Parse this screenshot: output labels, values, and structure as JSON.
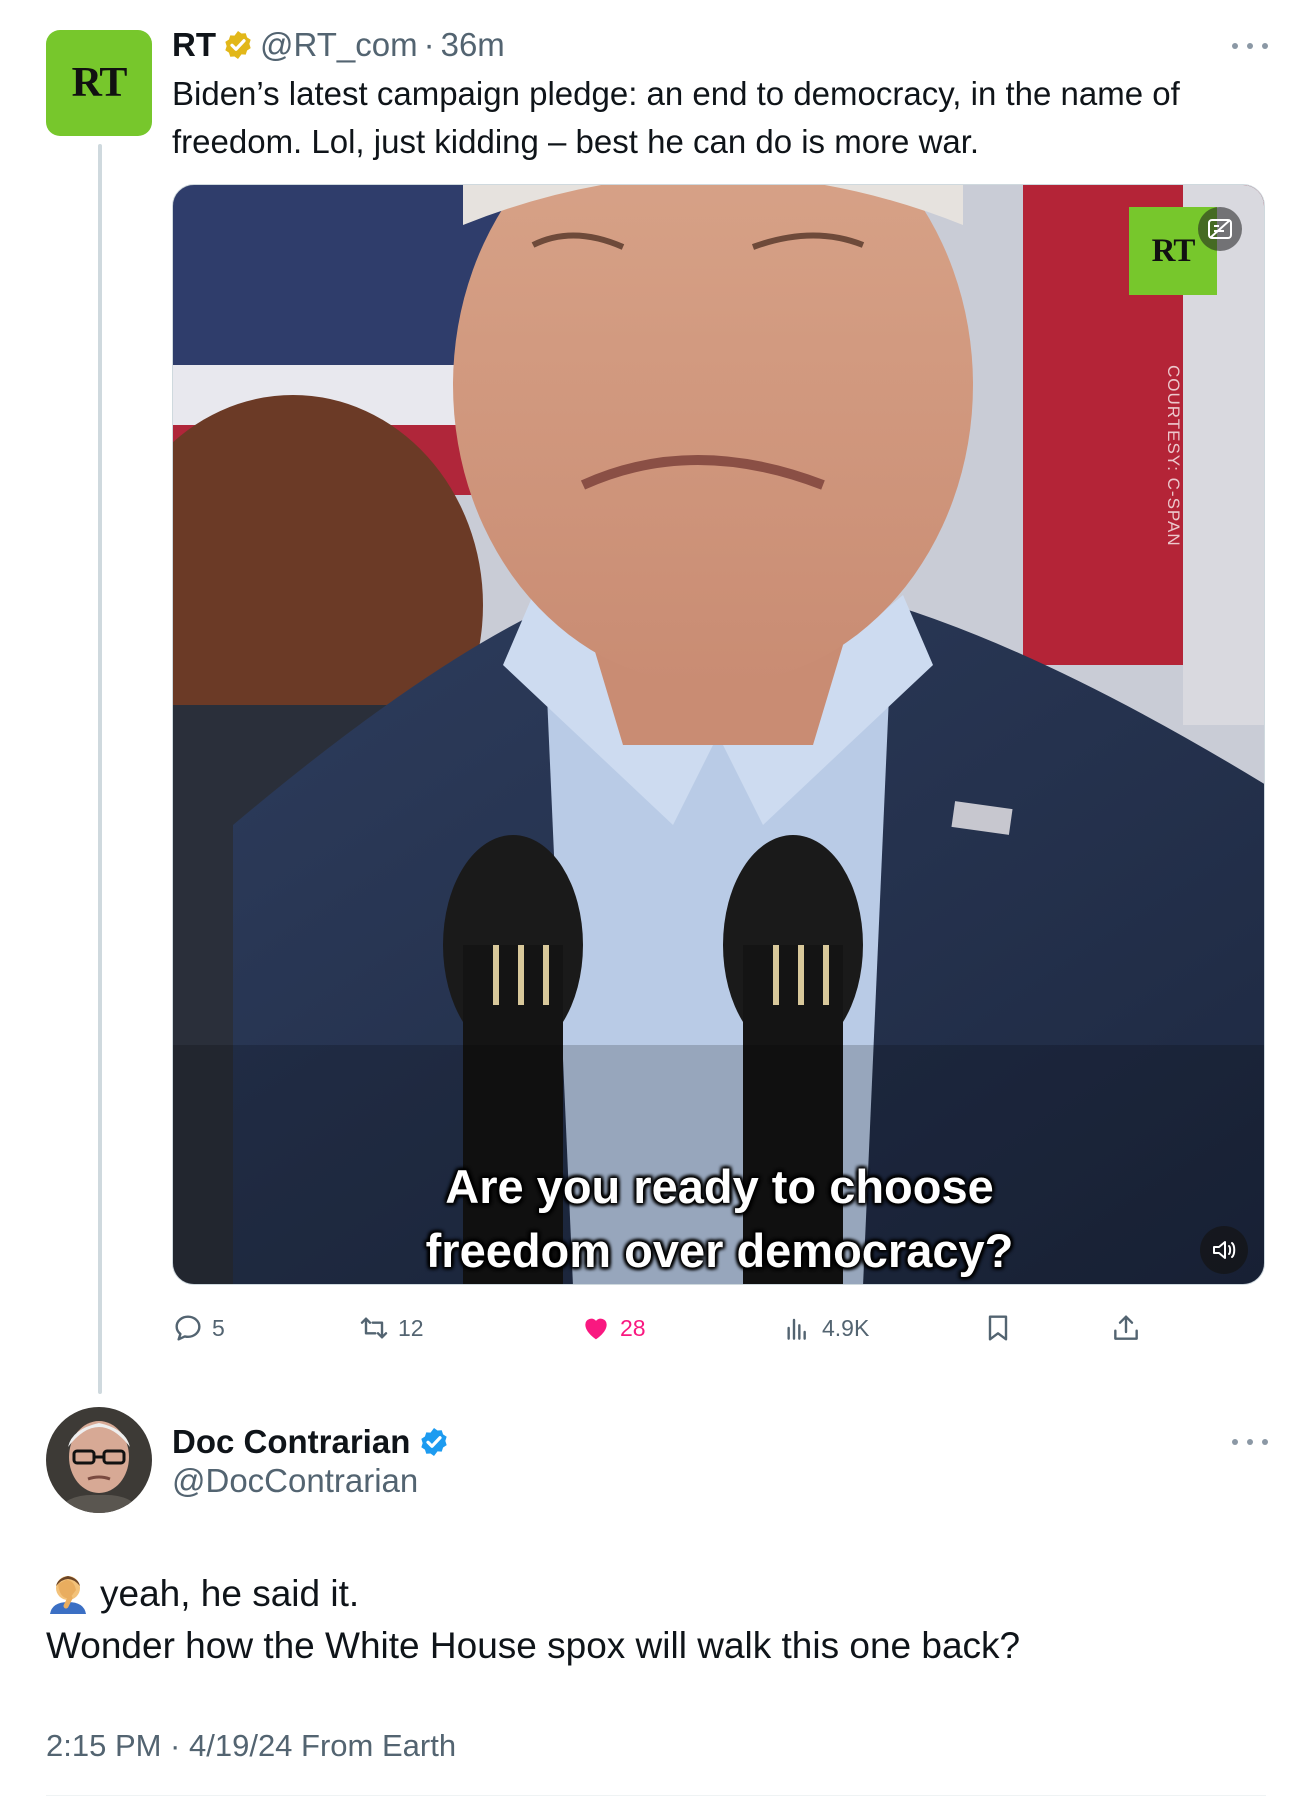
{
  "post1": {
    "display_name": "RT",
    "handle": "@RT_com",
    "separator": "·",
    "time": "36m",
    "avatar_text": "RT",
    "verification": "gold-verified-badge",
    "text": "Biden’s latest campaign pledge: an end to democracy, in the name of\nfreedom. Lol, just kidding – best he can do is more war.",
    "media": {
      "watermark": "RT",
      "courtesy": "COURTESY: C-SPAN",
      "caption": "Are you ready to choose\nfreedom over democracy?"
    },
    "actions": {
      "replies": "5",
      "reposts": "12",
      "likes": "28",
      "views": "4.9K"
    }
  },
  "post2": {
    "display_name": "Doc Contrarian",
    "handle": "@DocContrarian",
    "verification": "blue-verified-badge",
    "emoji": "facepalm",
    "line1": "yeah, he said it.",
    "line2": "Wonder how the White House spox will walk this one back?",
    "timestamp": "2:15 PM · 4/19/24 From Earth"
  },
  "colors": {
    "rt_green": "#77c72c",
    "like_pink": "#f91880",
    "secondary_text": "#536471",
    "verified_blue": "#1d9bf0",
    "verified_gold": "#e2b719"
  }
}
